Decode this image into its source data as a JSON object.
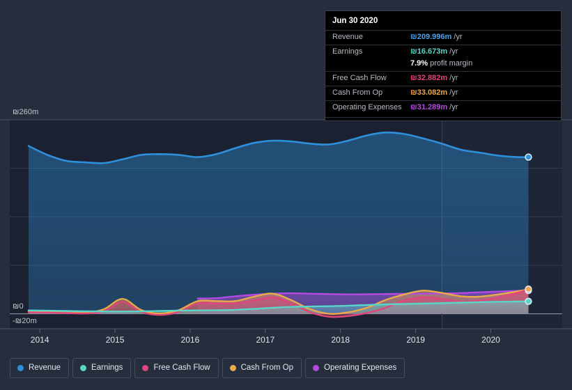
{
  "chart_data": {
    "type": "area",
    "title": "",
    "xlabel": "",
    "ylabel": "",
    "currency_symbol": "₪",
    "xlim": [
      2013.6,
      2020.95
    ],
    "ylim": [
      -20,
      260
    ],
    "grid": true,
    "y_ticks": [
      {
        "value": 260,
        "label": "₪260m"
      },
      {
        "value": 195,
        "label": ""
      },
      {
        "value": 130,
        "label": ""
      },
      {
        "value": 65,
        "label": ""
      },
      {
        "value": 0,
        "label": "₪0"
      },
      {
        "value": -20,
        "label": "-₪20m"
      }
    ],
    "x_ticks": [
      {
        "value": 2014,
        "label": "2014"
      },
      {
        "value": 2015,
        "label": "2015"
      },
      {
        "value": 2016,
        "label": "2016"
      },
      {
        "value": 2017,
        "label": "2017"
      },
      {
        "value": 2018,
        "label": "2018"
      },
      {
        "value": 2019,
        "label": "2019"
      },
      {
        "value": 2020,
        "label": "2020"
      }
    ],
    "forecast_divider_x": 2019.35,
    "legend_position": "bottom-left",
    "series": [
      {
        "name": "Revenue",
        "color": "#2e90da",
        "fill": "#2e90da",
        "x": [
          2013.85,
          2014.1,
          2014.35,
          2014.6,
          2014.85,
          2015.1,
          2015.35,
          2015.6,
          2015.85,
          2016.1,
          2016.35,
          2016.6,
          2016.85,
          2017.1,
          2017.35,
          2017.6,
          2017.85,
          2018.1,
          2018.35,
          2018.6,
          2018.85,
          2019.1,
          2019.35,
          2019.6,
          2019.85,
          2020.1,
          2020.35,
          2020.5
        ],
        "values": [
          225,
          213,
          205,
          203,
          202,
          207,
          213,
          214,
          213,
          210,
          214,
          222,
          229,
          232,
          231,
          228,
          227,
          232,
          239,
          243,
          241,
          235,
          228,
          220,
          216,
          212,
          210,
          210
        ]
      },
      {
        "name": "Earnings",
        "color": "#5ad6c8",
        "fill": "#5ad6c8",
        "x": [
          2013.85,
          2014.1,
          2014.35,
          2014.6,
          2014.85,
          2015.1,
          2015.35,
          2015.6,
          2015.85,
          2016.1,
          2016.35,
          2016.6,
          2016.85,
          2017.1,
          2017.35,
          2017.6,
          2017.85,
          2018.1,
          2018.35,
          2018.6,
          2018.85,
          2019.1,
          2019.35,
          2019.6,
          2019.85,
          2020.1,
          2020.35,
          2020.5
        ],
        "values": [
          4.5,
          4.2,
          3.8,
          3.4,
          3.1,
          3.0,
          3.3,
          3.8,
          4.3,
          4.6,
          4.8,
          5.3,
          6.5,
          8.1,
          9.2,
          9.8,
          10.2,
          10.9,
          11.8,
          12.6,
          13.2,
          13.8,
          14.3,
          15.0,
          15.6,
          16.1,
          16.5,
          16.673
        ]
      },
      {
        "name": "Free Cash Flow",
        "color": "#e0457b",
        "fill": "#e0457b",
        "x": [
          2013.85,
          2014.1,
          2014.35,
          2014.6,
          2014.85,
          2015.1,
          2015.35,
          2015.6,
          2015.85,
          2016.1,
          2016.35,
          2016.6,
          2016.85,
          2017.1,
          2017.35,
          2017.6,
          2017.85,
          2018.1,
          2018.35,
          2018.6,
          2018.85,
          2019.1,
          2019.35,
          2019.6,
          2019.85,
          2020.1,
          2020.35,
          2020.5
        ],
        "values": [
          2.0,
          1.5,
          1.0,
          0.5,
          3.0,
          16.0,
          2.5,
          -1.5,
          2.5,
          14.0,
          14.0,
          14.0,
          18.0,
          22.0,
          14.0,
          2.0,
          -4.0,
          -3.0,
          1.0,
          8.0,
          18.0,
          22.0,
          20.0,
          16.5,
          18.0,
          22.0,
          28.0,
          32.882
        ]
      },
      {
        "name": "Cash From Op",
        "color": "#eaa94a",
        "fill": "#eaa94a",
        "x": [
          2013.85,
          2014.1,
          2014.35,
          2014.6,
          2014.85,
          2015.1,
          2015.35,
          2015.6,
          2015.85,
          2016.1,
          2016.35,
          2016.6,
          2016.85,
          2017.1,
          2017.35,
          2017.6,
          2017.85,
          2018.1,
          2018.35,
          2018.6,
          2018.85,
          2019.1,
          2019.35,
          2019.6,
          2019.85,
          2020.1,
          2020.35,
          2020.5
        ],
        "values": [
          3.5,
          3.0,
          2.5,
          1.5,
          6.0,
          20.0,
          5.0,
          0.5,
          5.0,
          17.0,
          17.0,
          17.0,
          23.0,
          27.0,
          18.0,
          6.0,
          0.0,
          2.0,
          8.0,
          18.5,
          26.0,
          31.0,
          28.0,
          23.5,
          23.0,
          26.0,
          30.0,
          33.082
        ]
      },
      {
        "name": "Operating Expenses",
        "color": "#b44ae0",
        "fill": "#b44ae0",
        "x": [
          2016.1,
          2016.35,
          2016.6,
          2016.85,
          2017.1,
          2017.35,
          2017.6,
          2017.85,
          2018.1,
          2018.35,
          2018.6,
          2018.85,
          2019.1,
          2019.35,
          2019.6,
          2019.85,
          2020.1,
          2020.35,
          2020.5
        ],
        "values": [
          20.5,
          21.0,
          23.5,
          25.5,
          27.0,
          27.5,
          27.0,
          26.5,
          26.0,
          26.2,
          26.5,
          26.8,
          27.0,
          27.2,
          27.8,
          28.8,
          29.8,
          30.8,
          31.289
        ]
      }
    ],
    "endpoints": [
      {
        "series": "Revenue",
        "x": 2020.5,
        "value": 209.996
      },
      {
        "series": "Operating Expenses",
        "x": 2020.5,
        "value": 31.289
      },
      {
        "series": "Cash From Op",
        "x": 2020.5,
        "value": 33.082
      },
      {
        "series": "Earnings",
        "x": 2020.5,
        "value": 16.673
      }
    ]
  },
  "tooltip": {
    "title": "Jun 30 2020",
    "rows": [
      {
        "label": "Revenue",
        "value": "₪209.996m",
        "unit": "/yr",
        "color": "#4a9fe8"
      },
      {
        "label": "Earnings",
        "value": "₪16.673m",
        "unit": "/yr",
        "color": "#5ad6c8"
      },
      {
        "label": "",
        "value": "7.9%",
        "unit": "profit margin",
        "color": "#ffffff",
        "margin_row": true
      },
      {
        "label": "Free Cash Flow",
        "value": "₪32.882m",
        "unit": "/yr",
        "color": "#e0457b"
      },
      {
        "label": "Cash From Op",
        "value": "₪33.082m",
        "unit": "/yr",
        "color": "#eaa94a"
      },
      {
        "label": "Operating Expenses",
        "value": "₪31.289m",
        "unit": "/yr",
        "color": "#b44ae0"
      }
    ]
  },
  "legend": {
    "items": [
      {
        "label": "Revenue",
        "color": "#2e90da"
      },
      {
        "label": "Earnings",
        "color": "#5ad6c8"
      },
      {
        "label": "Free Cash Flow",
        "color": "#e0457b"
      },
      {
        "label": "Cash From Op",
        "color": "#eaa94a"
      },
      {
        "label": "Operating Expenses",
        "color": "#b44ae0"
      }
    ]
  },
  "theme": {
    "background": "#262d3d",
    "plot_background": "#1b2130",
    "gridline": "#39414f",
    "axis_text": "#dfe3ea"
  }
}
